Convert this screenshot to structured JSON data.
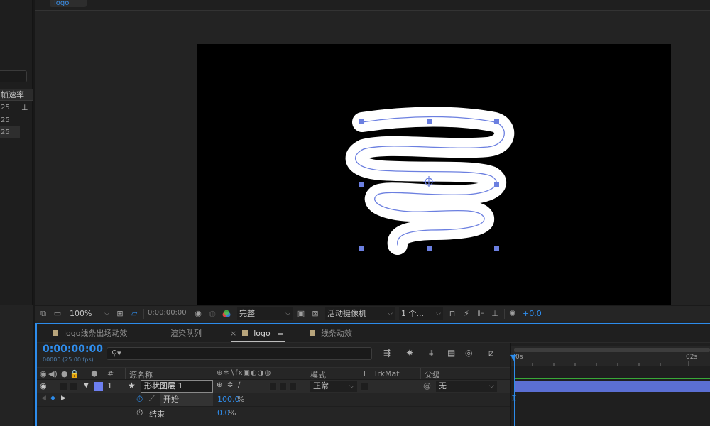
{
  "colors": {
    "accent": "#2d8ceb",
    "timecode": "#2f8ff0",
    "shape_stroke": "#ffffff",
    "path_blue": "#6b7fe0",
    "layer_bar": "#5b6fd3",
    "label_swatch": "#b8a57c",
    "layer_label": "#6d7ff0"
  },
  "viewer": {
    "tab_label": "logo"
  },
  "project_panel": {
    "column_header": "帧速率",
    "rows": [
      "25",
      "25",
      "25"
    ]
  },
  "viewer_toolbar": {
    "magnification": "100%",
    "timecode": "0:00:00:00",
    "resolution": "完整",
    "camera": "活动摄像机",
    "views": "1 个...",
    "exposure": "+0.0"
  },
  "timeline": {
    "tabs": [
      {
        "label": "logo线条出场动效"
      },
      {
        "label": "渲染队列"
      },
      {
        "label": "logo",
        "active": true
      },
      {
        "label": "线条动效"
      }
    ],
    "close_glyph": "×",
    "menu_glyph": "≡",
    "current_time": "0:00:00:00",
    "current_time_sub": "00000 (25.00 fps)",
    "columns": {
      "hash": "#",
      "source_name": "源名称",
      "mode": "模式",
      "t": "T",
      "trkmat": "TrkMat",
      "parent": "父级"
    },
    "layer": {
      "number": "1",
      "name": "形状图层 1",
      "mode": "正常",
      "parent": "无"
    },
    "properties": [
      {
        "name": "开始",
        "value": "100.0",
        "unit": "%"
      },
      {
        "name": "结束",
        "value": "0.0",
        "unit": "%"
      }
    ],
    "ruler": {
      "start": "0s",
      "mark": "02s"
    }
  }
}
